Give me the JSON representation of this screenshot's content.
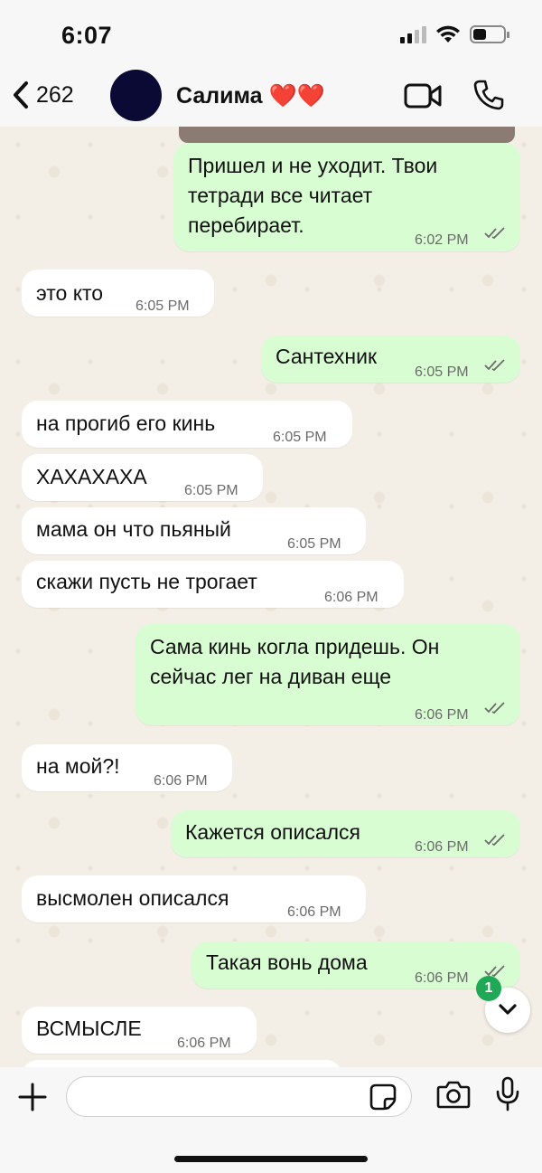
{
  "status_bar": {
    "time": "6:07"
  },
  "header": {
    "back_count": "262",
    "contact_name": "Салима ❤️❤️"
  },
  "messages": [
    {
      "dir": "out",
      "lines": [
        "Пришел и не уходит. Твои",
        "тетради все читает",
        "перебирает."
      ],
      "time": "6:02 PM",
      "read": true
    },
    {
      "dir": "in",
      "lines": [
        "это кто"
      ],
      "time": "6:05 PM"
    },
    {
      "dir": "out",
      "lines": [
        "Сантехник"
      ],
      "time": "6:05 PM",
      "read": true
    },
    {
      "dir": "in",
      "lines": [
        "на прогиб его кинь"
      ],
      "time": "6:05 PM"
    },
    {
      "dir": "in",
      "lines": [
        "ХАХАХАХА"
      ],
      "time": "6:05 PM"
    },
    {
      "dir": "in",
      "lines": [
        "мама он что пьяный"
      ],
      "time": "6:05 PM"
    },
    {
      "dir": "in",
      "lines": [
        "скажи пусть не трогает"
      ],
      "time": "6:06 PM"
    },
    {
      "dir": "out",
      "lines": [
        "Сама кинь когла придешь.  Он",
        "сейчас лег на диван еще"
      ],
      "time": "6:06 PM",
      "read": true
    },
    {
      "dir": "in",
      "lines": [
        "на мой?!"
      ],
      "time": "6:06 PM"
    },
    {
      "dir": "out",
      "lines": [
        "Кажется описался"
      ],
      "time": "6:06 PM",
      "read": true
    },
    {
      "dir": "in",
      "lines": [
        "высмолен описался"
      ],
      "time": "6:06 PM"
    },
    {
      "dir": "out",
      "lines": [
        "Такая вонь дома"
      ],
      "time": "6:06 PM",
      "read": true
    },
    {
      "dir": "in",
      "lines": [
        "ВСМЫСЛЕ"
      ],
      "time": "6:06 PM"
    }
  ],
  "scroll_button": {
    "unread_count": "1"
  },
  "input_bar": {
    "message_value": "",
    "message_placeholder": ""
  },
  "colors": {
    "outgoing_bubble": "#d9fdd3",
    "incoming_bubble": "#ffffff",
    "read_ticks": "#6b6b6b",
    "unread_badge": "#1fa855",
    "avatar": "#0a0a35"
  }
}
